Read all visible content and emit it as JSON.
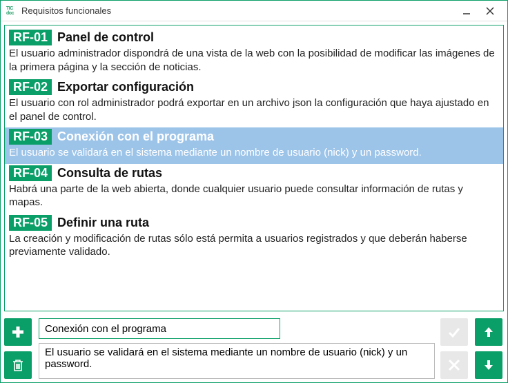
{
  "window": {
    "title": "Requisitos funcionales",
    "icon_top": "TIC",
    "icon_bottom": "doc"
  },
  "items": [
    {
      "code": "RF-01",
      "title": "Panel de control",
      "desc": "El usuario administrador dispondrá de una vista de la web con la posibilidad de modificar las imágenes de la primera página y la sección de noticias.",
      "selected": false
    },
    {
      "code": "RF-02",
      "title": "Exportar configuración",
      "desc": "El usuario con rol administrador podrá exportar en un archivo json la configuración que haya ajustado en el panel de control.",
      "selected": false
    },
    {
      "code": "RF-03",
      "title": "Conexión con el programa",
      "desc": "El usuario se validará en el sistema mediante un nombre de usuario (nick) y un password.",
      "selected": true
    },
    {
      "code": "RF-04",
      "title": "Consulta de rutas",
      "desc": "Habrá una parte de la web abierta, donde cualquier usuario puede consultar información de rutas y mapas.",
      "selected": false
    },
    {
      "code": "RF-05",
      "title": "Definir una ruta",
      "desc": "La creación y modificación de rutas sólo está permita a usuarios registrados y que deberán haberse previamente validado.",
      "selected": false
    }
  ],
  "editor": {
    "title_value": "Conexión con el programa",
    "desc_value": "El usuario se validará en el sistema mediante un nombre de usuario (nick) y un password."
  }
}
